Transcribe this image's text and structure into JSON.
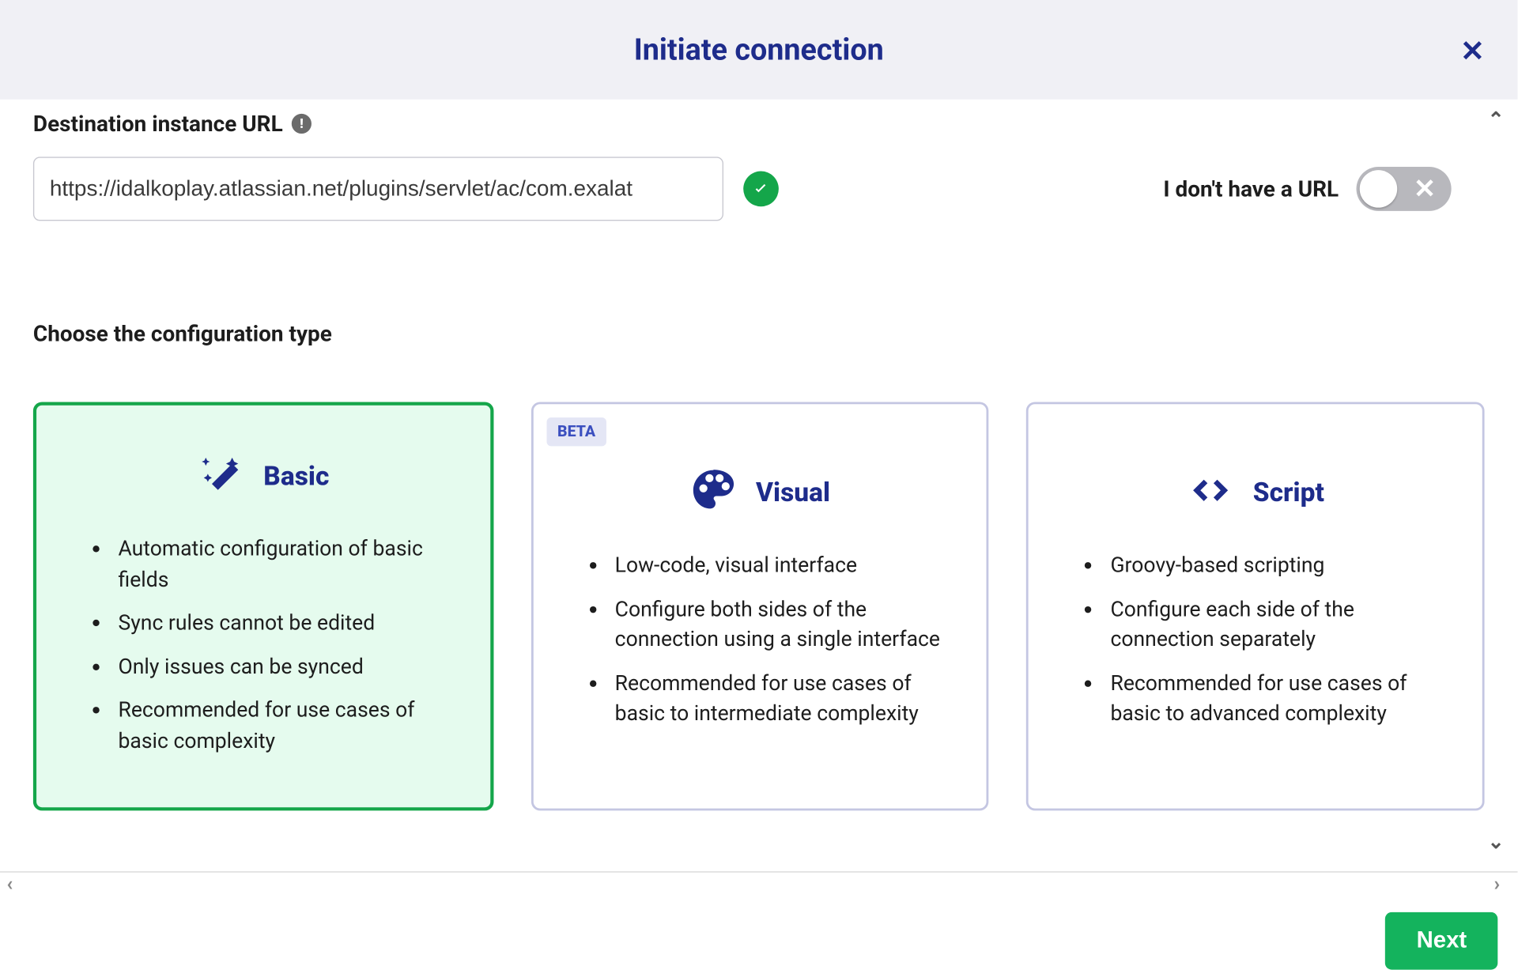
{
  "header": {
    "title": "Initiate connection",
    "close_label": "✕"
  },
  "url_section": {
    "label": "Destination instance URL",
    "value": "https://idalkoplay.atlassian.net/plugins/servlet/ac/com.exalat",
    "valid": true
  },
  "toggle": {
    "label": "I don't have a URL",
    "on": false,
    "x_label": "✕"
  },
  "config_section": {
    "title": "Choose the configuration type"
  },
  "cards": [
    {
      "id": "basic",
      "title": "Basic",
      "selected": true,
      "badge": null,
      "icon": "wand-icon",
      "features": [
        "Automatic configuration of basic fields",
        "Sync rules cannot be edited",
        "Only issues can be synced",
        "Recommended for use cases of basic complexity"
      ]
    },
    {
      "id": "visual",
      "title": "Visual",
      "selected": false,
      "badge": "BETA",
      "icon": "palette-icon",
      "features": [
        "Low-code, visual interface",
        "Configure both sides of the connection using a single interface",
        "Recommended for use cases of basic to intermediate complexity"
      ]
    },
    {
      "id": "script",
      "title": "Script",
      "selected": false,
      "badge": null,
      "icon": "code-icon",
      "features": [
        "Groovy-based scripting",
        "Configure each side of the connection separately",
        "Recommended for use cases of basic to advanced complexity"
      ]
    }
  ],
  "footer": {
    "next_label": "Next"
  },
  "carets": {
    "up": "⌃",
    "down": "⌄",
    "left": "‹",
    "right": "›"
  }
}
